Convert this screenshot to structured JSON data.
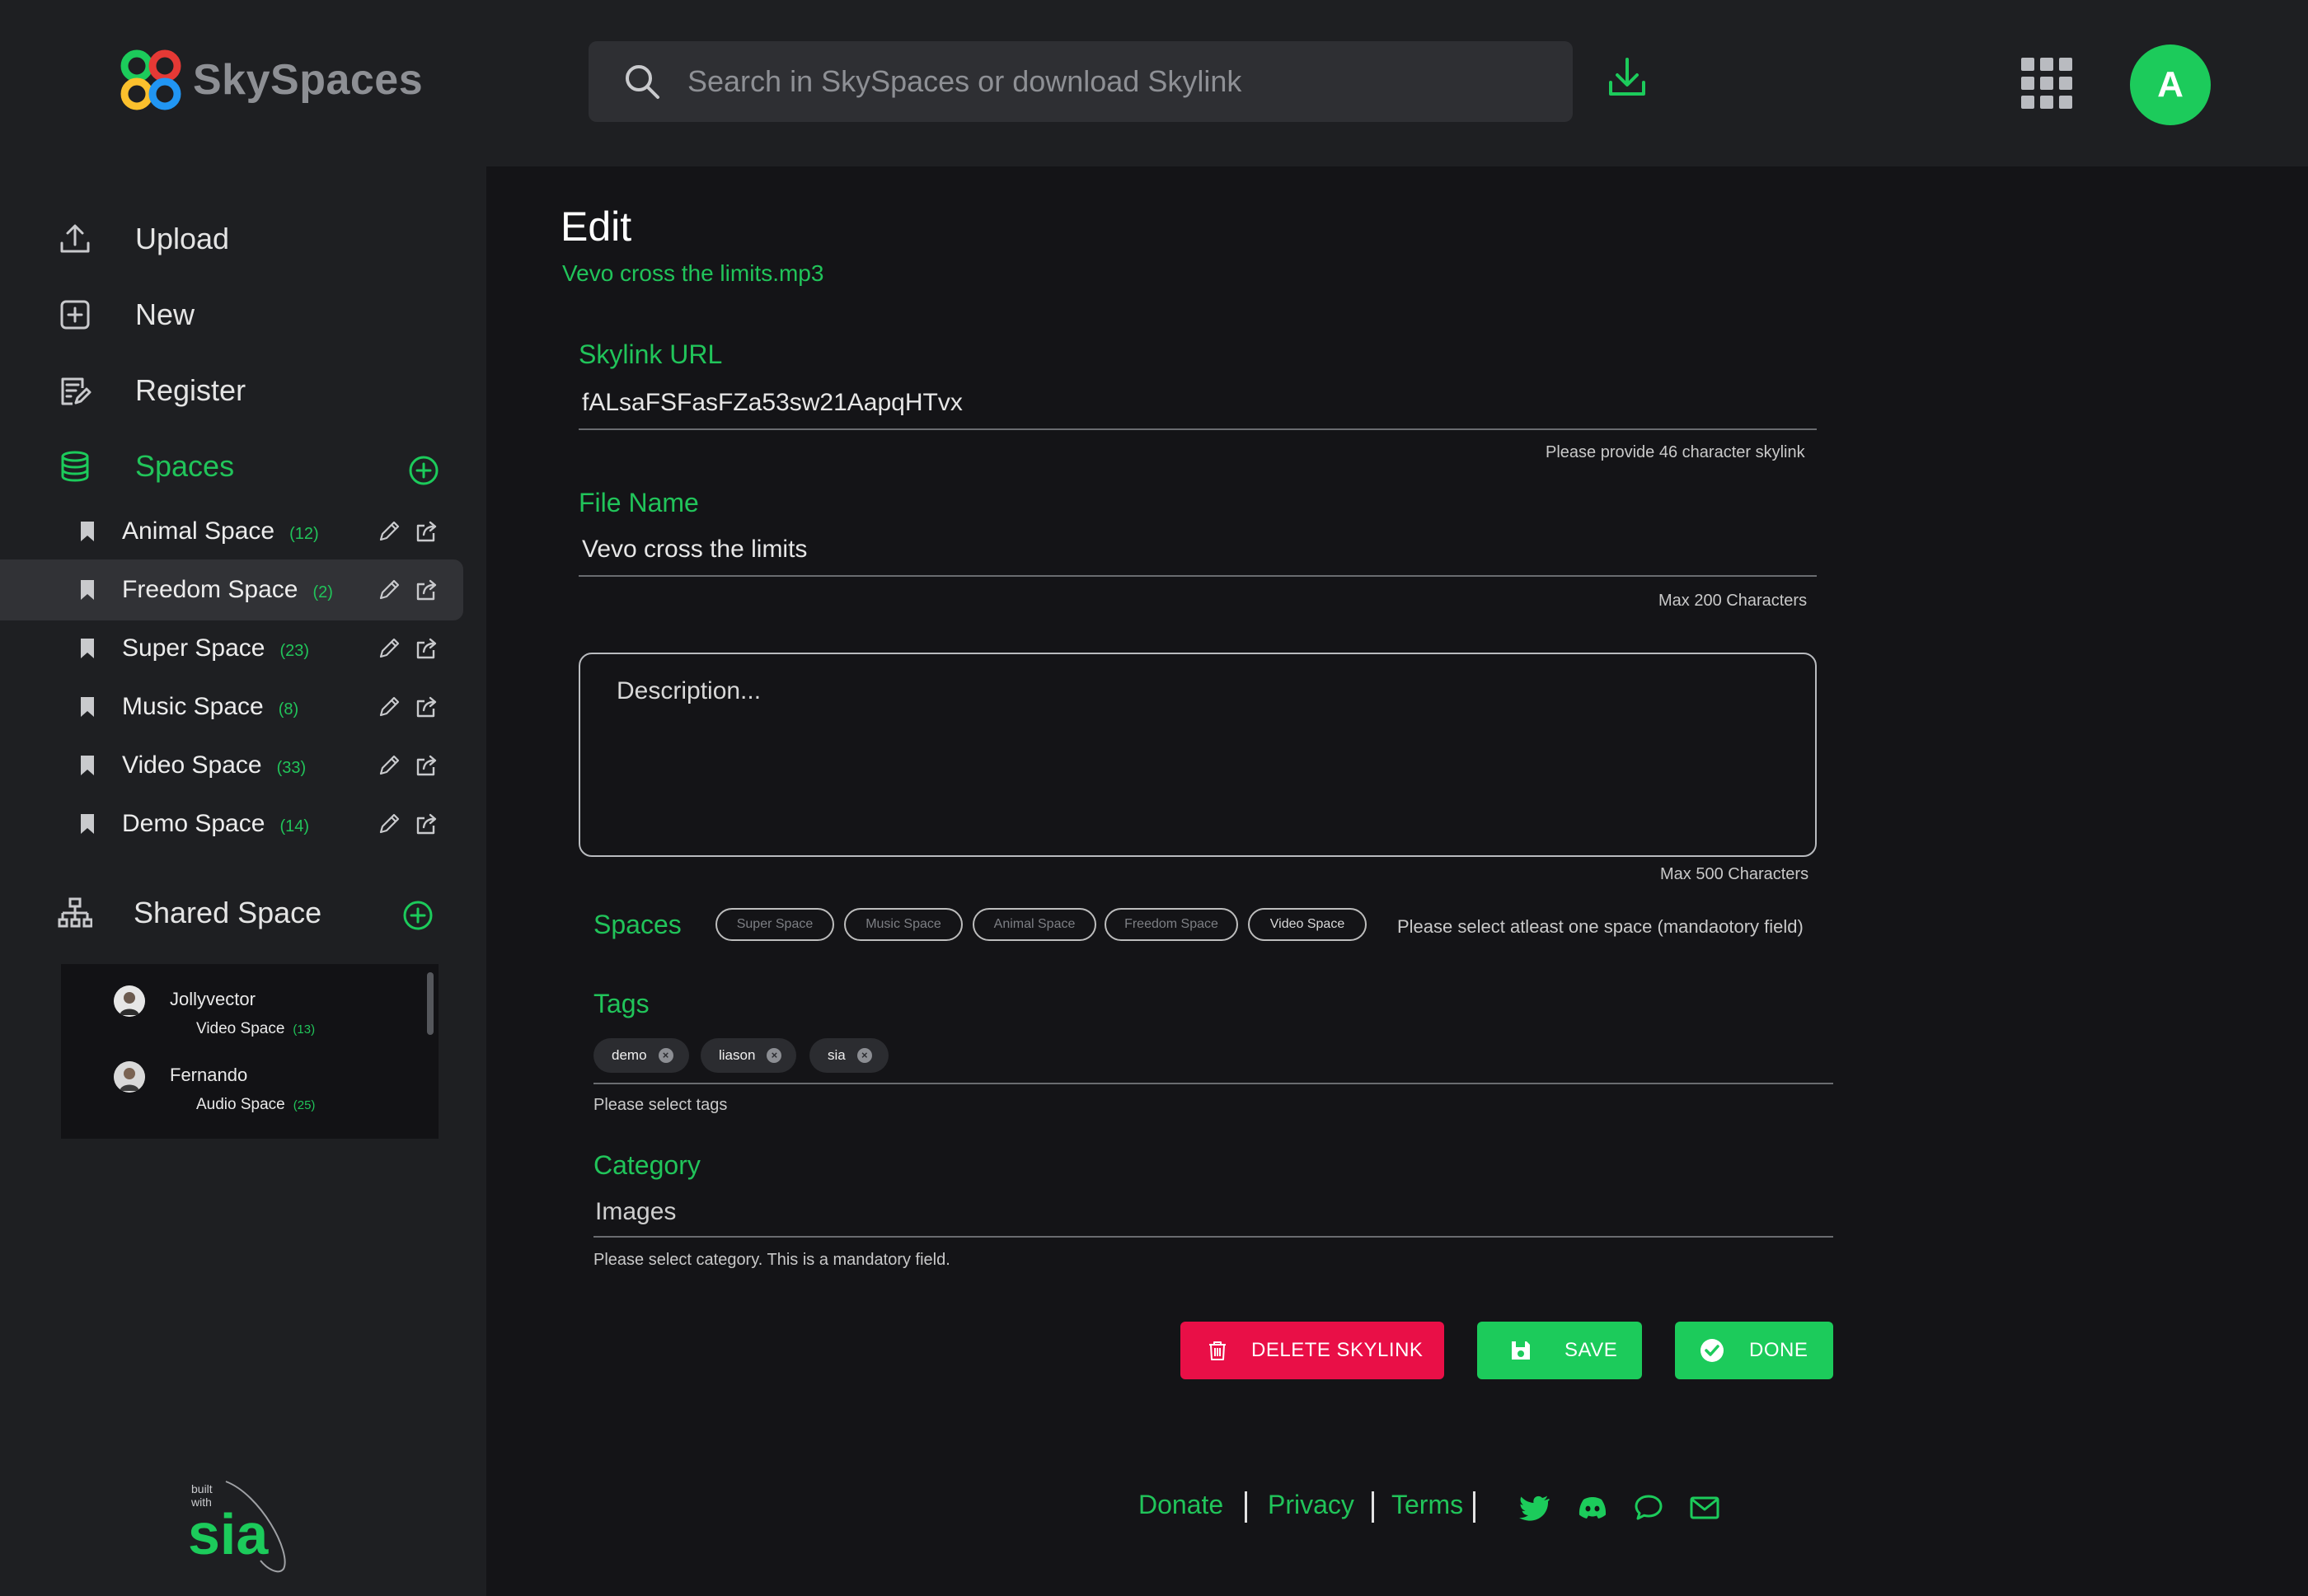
{
  "header": {
    "logo_text": "SkySpaces",
    "search_placeholder": "Search in SkySpaces or download Skylink",
    "avatar_letter": "A"
  },
  "sidebar": {
    "nav": [
      {
        "label": "Upload",
        "icon": "upload-icon"
      },
      {
        "label": "New",
        "icon": "plus-square-icon"
      },
      {
        "label": "Register",
        "icon": "register-icon"
      }
    ],
    "spaces_label": "Spaces",
    "spaces": [
      {
        "name": "Animal Space",
        "count": "(12)"
      },
      {
        "name": "Freedom Space",
        "count": "(2)"
      },
      {
        "name": "Super Space",
        "count": "(23)"
      },
      {
        "name": "Music Space",
        "count": "(8)"
      },
      {
        "name": "Video Space",
        "count": "(33)"
      },
      {
        "name": "Demo Space",
        "count": "(14)"
      }
    ],
    "active_space": "Freedom Space",
    "shared_label": "Shared Space",
    "shared": [
      {
        "user": "Jollyvector",
        "space": "Video Space",
        "count": "(13)"
      },
      {
        "user": "Fernando",
        "space": "Audio Space",
        "count": "(25)"
      }
    ]
  },
  "main": {
    "title": "Edit",
    "file_subtitle": "Vevo cross the limits.mp3",
    "skylink": {
      "label": "Skylink URL",
      "value": "fALsaFSFasFZa53sw21AapqHTvx",
      "hint": "Please provide 46 character skylink"
    },
    "filename": {
      "label": "File Name",
      "value": "Vevo cross the limits",
      "hint": "Max 200 Characters"
    },
    "description": {
      "placeholder": "Description...",
      "hint": "Max 500 Characters"
    },
    "spaces": {
      "label": "Spaces",
      "chips": [
        {
          "label": "Super Space",
          "selected": false
        },
        {
          "label": "Music Space",
          "selected": false
        },
        {
          "label": "Animal Space",
          "selected": false
        },
        {
          "label": "Freedom Space",
          "selected": false
        },
        {
          "label": "Video Space",
          "selected": true
        }
      ],
      "hint": "Please select atleast one space (mandaotory field)"
    },
    "tags": {
      "label": "Tags",
      "items": [
        "demo",
        "liason",
        "sia"
      ],
      "hint": "Please select tags"
    },
    "category": {
      "label": "Category",
      "value": "Images",
      "hint": "Please select category. This is a mandatory field."
    },
    "buttons": {
      "delete": "DELETE SKYLINK",
      "save": "SAVE",
      "done": "DONE"
    }
  },
  "footer": {
    "links": [
      "Donate",
      "Privacy",
      "Terms"
    ],
    "social_icons": [
      "twitter-icon",
      "discord-icon",
      "chat-icon",
      "mail-icon"
    ]
  },
  "brand": {
    "built_with_top": "built",
    "built_with_bottom": "with",
    "sia_logo": "sia"
  },
  "colors": {
    "accent_green": "#1ccb5b",
    "danger_red": "#e90f47",
    "background": "#141417",
    "panel": "#1e1f22"
  }
}
